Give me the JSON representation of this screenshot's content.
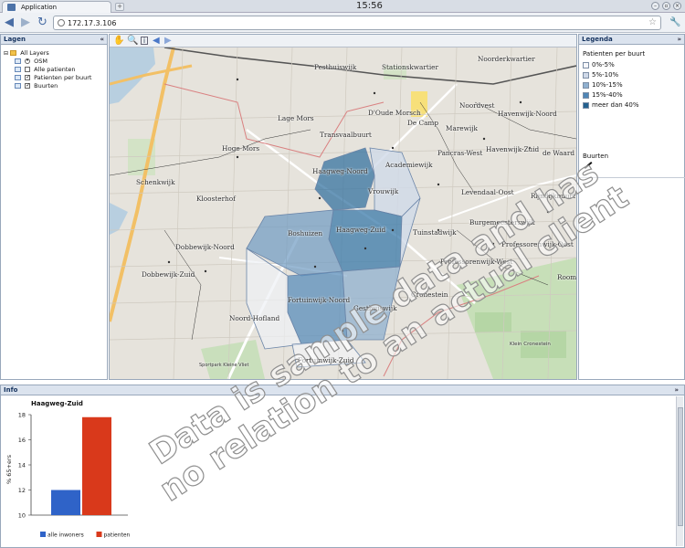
{
  "browser": {
    "tab_title": "Application",
    "clock": "15:56",
    "url": "172.17.3.106",
    "back_icon": "back-arrow-icon",
    "forward_icon": "forward-arrow-icon",
    "reload_icon": "reload-icon"
  },
  "lagen": {
    "title": "Lagen",
    "tree": [
      {
        "label": "All Layers",
        "type": "folder",
        "checked": null,
        "depth": 0
      },
      {
        "label": "OSM",
        "type": "layer",
        "checked": "radio",
        "depth": 1
      },
      {
        "label": "Alle patienten",
        "type": "layer",
        "checked": false,
        "depth": 1
      },
      {
        "label": "Patienten per buurt",
        "type": "layer",
        "checked": true,
        "depth": 1
      },
      {
        "label": "Buurten",
        "type": "layer",
        "checked": true,
        "depth": 1
      }
    ]
  },
  "map": {
    "tools": [
      "pan-hand-icon",
      "zoom-icon",
      "info-icon",
      "back-icon",
      "forward-icon"
    ],
    "places": [
      "Pesthuiswijk",
      "Stationskwartier",
      "Noorderkwartier",
      "Lage Mors",
      "D'Oude Morsch",
      "Noordvest",
      "Havenwijk-Noord",
      "De Camp",
      "Marewijk",
      "Transvaalbuurt",
      "Hoge Mors",
      "Pancras-West",
      "Havenwijk-Zuid",
      "de Waard",
      "Academiewijk",
      "Haagweg-Noord",
      "Vrouwijk",
      "Levendaal-Oost",
      "Rijndijkbuurt",
      "Schenkwijk",
      "Kloosterhof",
      "Burgemeesterswijk",
      "Boshuizen",
      "Haagweg-Zuid",
      "Tuinstadwijk",
      "Professorenwijk-Oost",
      "Dobbewijk-Noord",
      "Professorenwijk-West",
      "Dobbewijk-Zuid",
      "Roomburg",
      "Fortuinwijk-Noord",
      "Cronestein",
      "Gesthuiswijk",
      "Noord-Hofland",
      "Sportpark Kleine Vliet",
      "Klein Cronestein",
      "Fortuinwijk-Zuid"
    ]
  },
  "legenda": {
    "title": "Legenda",
    "subtitle": "Patienten per buurt",
    "classes": [
      {
        "label": "0%-5%",
        "color": "#f6f7fa"
      },
      {
        "label": "5%-10%",
        "color": "#cfd9e8"
      },
      {
        "label": "10%-15%",
        "color": "#8fb0cf"
      },
      {
        "label": "15%-40%",
        "color": "#4f86b6"
      },
      {
        "label": "meer dan 40%",
        "color": "#24618f"
      }
    ],
    "buurten_label": "Buurten"
  },
  "info": {
    "title": "Info",
    "chart_title": "Haagweg-Zuid"
  },
  "chart_data": {
    "type": "bar",
    "title": "Haagweg-Zuid",
    "ylabel": "% 65+ers",
    "xlabel": "",
    "ylim": [
      10,
      18
    ],
    "yticks": [
      10,
      12,
      14,
      16,
      18
    ],
    "series": [
      {
        "name": "alle inwoners",
        "values": [
          12.0
        ],
        "color": "#2f63c8"
      },
      {
        "name": "patienten",
        "values": [
          17.8
        ],
        "color": "#d9391b"
      }
    ],
    "legend_position": "bottom"
  },
  "watermark": {
    "line1": "Data is sample data and has",
    "line2": "no relation to an actual client"
  }
}
